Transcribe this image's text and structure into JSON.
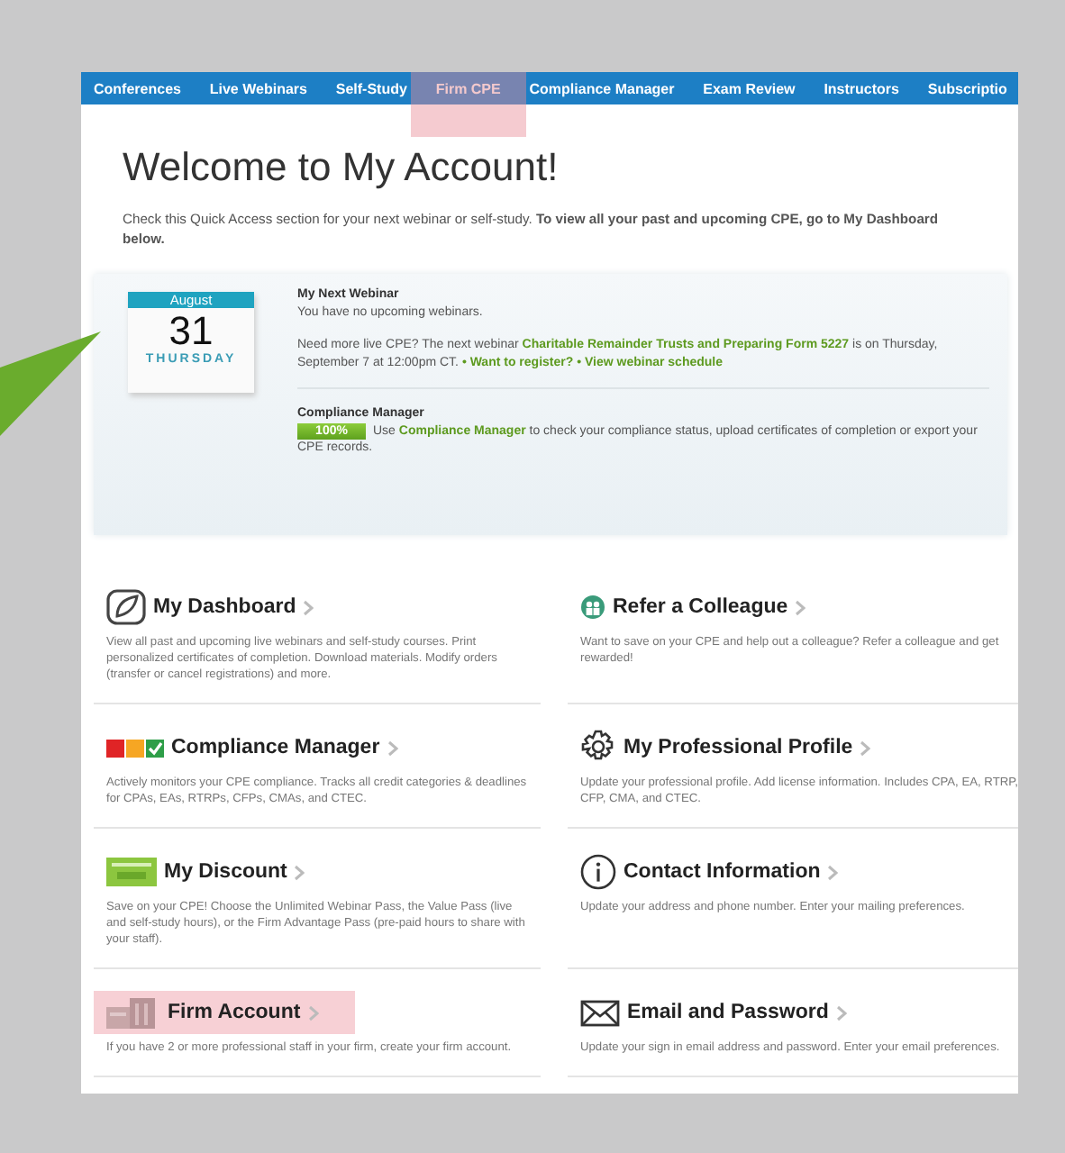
{
  "nav": [
    {
      "label": "Conferences",
      "highlighted": false
    },
    {
      "label": "Live Webinars",
      "highlighted": false
    },
    {
      "label": "Self-Study",
      "highlighted": false
    },
    {
      "label": "Firm CPE",
      "highlighted": true
    },
    {
      "label": "Compliance Manager",
      "highlighted": false
    },
    {
      "label": "Exam Review",
      "highlighted": false
    },
    {
      "label": "Instructors",
      "highlighted": false
    },
    {
      "label": "Subscriptio",
      "highlighted": false
    }
  ],
  "page_title": "Welcome to My Account!",
  "intro": "Check this Quick Access section for your next webinar or self-study. **To view all your past and upcoming CPE, go to My Dashboard below.**",
  "calendar": {
    "month": "August",
    "day": "31",
    "weekday": "THURSDAY"
  },
  "next_webinar": {
    "heading": "My Next Webinar",
    "status": "You have no upcoming webinars.",
    "promo_lead": "Need more live CPE? The next webinar",
    "webinar_link": "Charitable Remainder Trusts and Preparing Form 5227",
    "promo_tail": "is on Thursday, September 7 at 12:00pm CT.",
    "links": [
      "• Want to register?",
      "• View webinar schedule"
    ]
  },
  "compliance": {
    "heading": "Compliance Manager",
    "badge": "100%",
    "lead": "Use",
    "link": "Compliance Manager",
    "tail": "to check your compliance status, upload certificates of completion or export your CPE records."
  },
  "tiles": [
    {
      "kind": "dashboard",
      "title": "My Dashboard",
      "description": "View all past and upcoming live webinars and self-study courses. Print personalized certificates of completion. Download materials. Modify orders (transfer or cancel registrations) and more.",
      "highlighted": false
    },
    {
      "kind": "refer",
      "title": "Refer a Colleague",
      "description": "Want to save on your CPE and help out a colleague? Refer a colleague and get rewarded!",
      "highlighted": false
    },
    {
      "kind": "compliance",
      "title": "Compliance Manager",
      "description": "Actively monitors your CPE compliance. Tracks all credit categories & deadlines for CPAs, EAs, RTRPs, CFPs, CMAs, and CTEC.",
      "highlighted": false
    },
    {
      "kind": "profile",
      "title": "My Professional Profile",
      "description": "Update your professional profile. Add license information. Includes CPA, EA, RTRP, CFP, CMA, and CTEC.",
      "highlighted": false
    },
    {
      "kind": "discount",
      "title": "My Discount",
      "description": "Save on your CPE! Choose the Unlimited Webinar Pass, the Value Pass (live and self-study hours), or the Firm Advantage Pass (pre-paid hours to share with your staff).",
      "highlighted": false
    },
    {
      "kind": "contact",
      "title": "Contact Information",
      "description": "Update your address and phone number. Enter your mailing preferences.",
      "highlighted": false
    },
    {
      "kind": "firm",
      "title": "Firm Account",
      "description": "If you have 2 or more professional staff in your firm, create your firm account.",
      "highlighted": true
    },
    {
      "kind": "email",
      "title": "Email and Password",
      "description": "Update your sign in email address and password. Enter your email preferences.",
      "highlighted": false
    }
  ]
}
